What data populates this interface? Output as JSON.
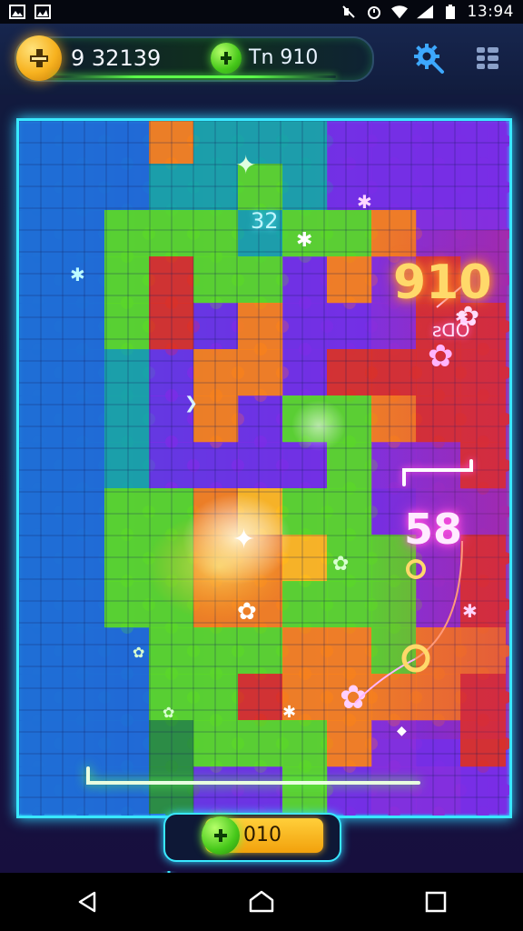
{
  "status_bar": {
    "time": "13:94",
    "icons": [
      "image-icon",
      "gallery-icon",
      "mute-icon",
      "alarm-icon",
      "wifi-icon",
      "signal-icon",
      "battery-icon"
    ]
  },
  "header": {
    "score": "9 32139",
    "target": "Tn 910",
    "gear_icon": "settings-gear-icon",
    "menu_icon": "menu-grid-icon"
  },
  "board": {
    "floating_labels": {
      "top_center": "32",
      "big_right": "910",
      "small_right": "ƨᗡO",
      "bracket": "58"
    }
  },
  "footer": {
    "value": "010"
  },
  "nav": {
    "back": "back-icon",
    "home": "home-icon",
    "recents": "recents-icon"
  },
  "colors": {
    "border_glow": "#39e8ff",
    "gold": "#f7b21f",
    "green_coin": "#46c81a",
    "pink_glow": "#ff4fe0"
  }
}
